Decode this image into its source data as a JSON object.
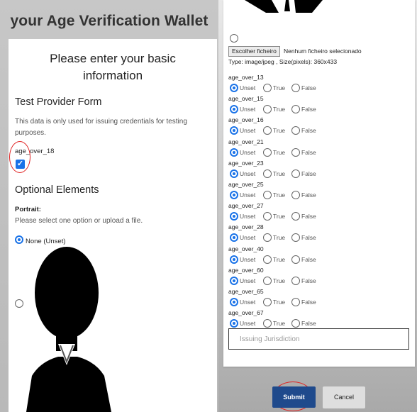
{
  "app": {
    "title": "your Age Verification Wallet"
  },
  "form": {
    "heading": "Please enter your basic information",
    "provider_title": "Test Provider Form",
    "description": "This data is only used for issuing credentials for testing purposes.",
    "age_over_18_label": "age_over_18",
    "age_over_18_checked": true,
    "optional_title": "Optional Elements",
    "portrait_label": "Portrait:",
    "portrait_hint": "Please select one option or upload a file.",
    "portrait_none_option": "None (Unset)"
  },
  "upload": {
    "choose_file_button": "Escolher ficheiro",
    "no_file_text": "Nenhum ficheiro selecionado",
    "type_hint": "Type: image/jpeg , Size(pixels): 360x433"
  },
  "age_fields": [
    {
      "label": "age_over_13",
      "options": [
        "Unset",
        "True",
        "False"
      ],
      "selected": "Unset"
    },
    {
      "label": "age_over_15",
      "options": [
        "Unset",
        "True",
        "False"
      ],
      "selected": "Unset"
    },
    {
      "label": "age_over_16",
      "options": [
        "Unset",
        "True",
        "False"
      ],
      "selected": "Unset"
    },
    {
      "label": "age_over_21",
      "options": [
        "Unset",
        "True",
        "False"
      ],
      "selected": "Unset"
    },
    {
      "label": "age_over_23",
      "options": [
        "Unset",
        "True",
        "False"
      ],
      "selected": "Unset"
    },
    {
      "label": "age_over_25",
      "options": [
        "Unset",
        "True",
        "False"
      ],
      "selected": "Unset"
    },
    {
      "label": "age_over_27",
      "options": [
        "Unset",
        "True",
        "False"
      ],
      "selected": "Unset"
    },
    {
      "label": "age_over_28",
      "options": [
        "Unset",
        "True",
        "False"
      ],
      "selected": "Unset"
    },
    {
      "label": "age_over_40",
      "options": [
        "Unset",
        "True",
        "False"
      ],
      "selected": "Unset"
    },
    {
      "label": "age_over_60",
      "options": [
        "Unset",
        "True",
        "False"
      ],
      "selected": "Unset"
    },
    {
      "label": "age_over_65",
      "options": [
        "Unset",
        "True",
        "False"
      ],
      "selected": "Unset"
    },
    {
      "label": "age_over_67",
      "options": [
        "Unset",
        "True",
        "False"
      ],
      "selected": "Unset"
    }
  ],
  "jurisdiction": {
    "placeholder": "Issuing Jurisdiction"
  },
  "actions": {
    "submit_label": "Submit",
    "cancel_label": "Cancel"
  },
  "colors": {
    "accent": "#1a73e8",
    "submit_bg": "#1f4a8c",
    "annotation": "#e02020"
  }
}
